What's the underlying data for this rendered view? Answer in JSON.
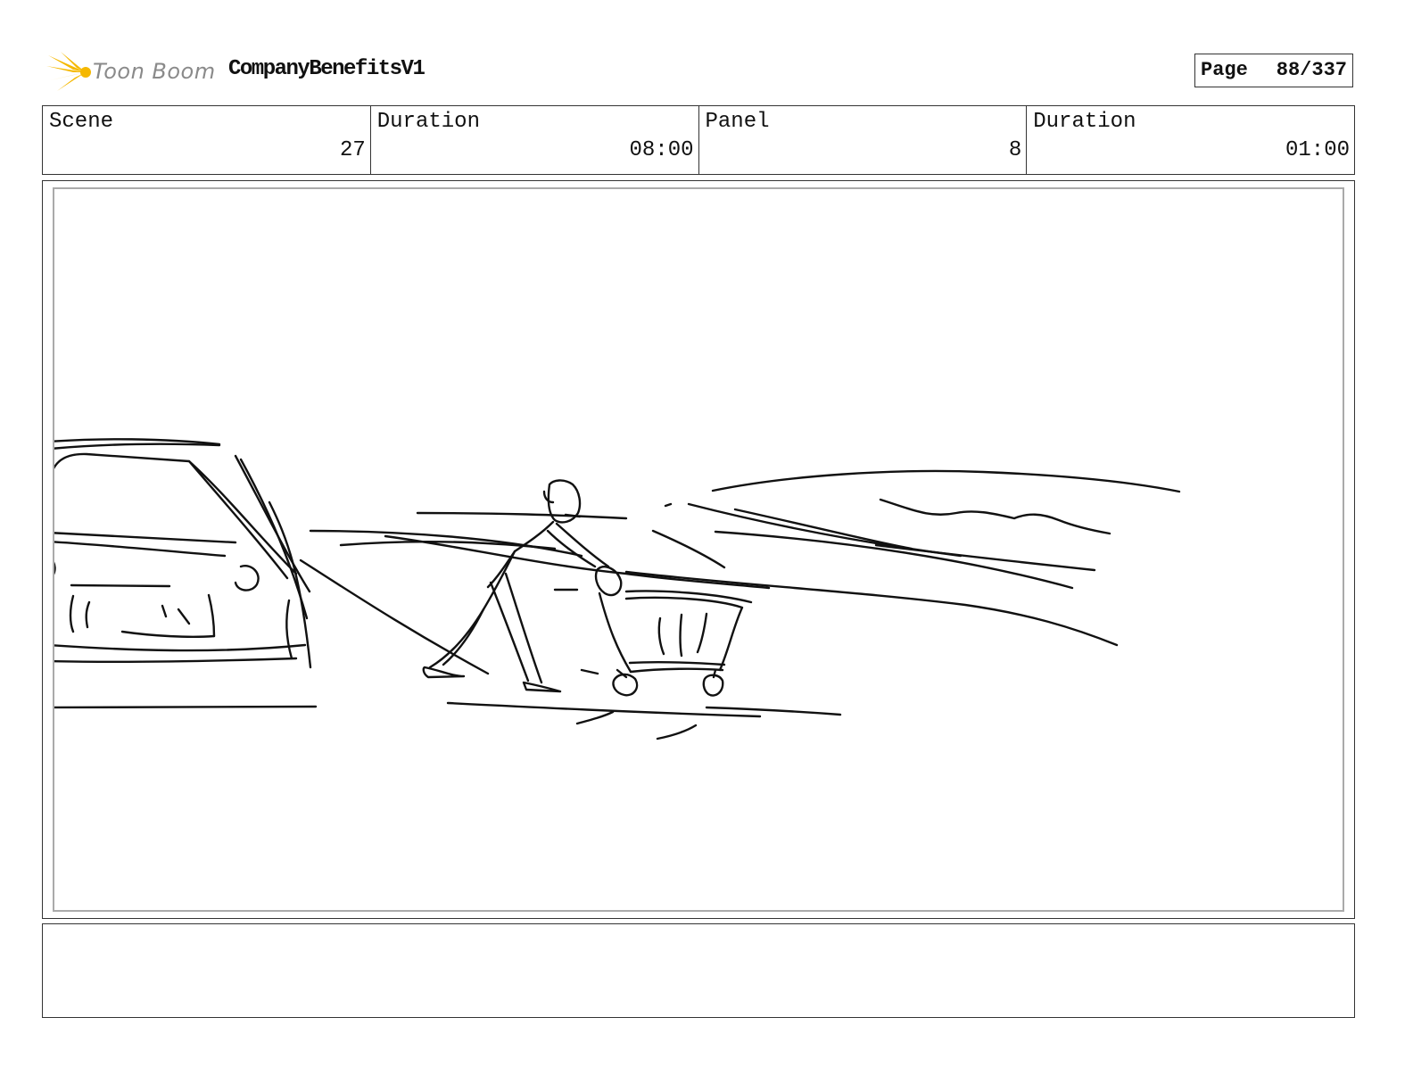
{
  "header": {
    "logo_text": "Toon Boom",
    "project_title": "CompanyBenefitsV1",
    "page_label": "Page",
    "page_number": "88/337"
  },
  "info": {
    "scene_label": "Scene",
    "scene_value": "27",
    "scene_duration_label": "Duration",
    "scene_duration_value": "08:00",
    "panel_label": "Panel",
    "panel_value": "8",
    "panel_duration_label": "Duration",
    "panel_duration_value": "01:00"
  },
  "colors": {
    "logo_star": "#f5b800",
    "logo_text": "#8a8a8a",
    "border": "#333333",
    "inner_border": "#aaaaaa"
  },
  "notes": ""
}
